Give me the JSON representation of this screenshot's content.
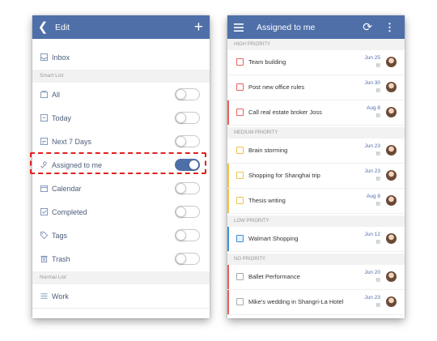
{
  "colors": {
    "accent": "#4f6fa8",
    "high": "#e86060",
    "medium": "#f2c14e",
    "low": "#3f8fd6",
    "highlight": "#e02020"
  },
  "left": {
    "header": {
      "back_icon": "back-arrow-icon",
      "title": "Edit",
      "add_icon": "plus-icon"
    },
    "inbox": {
      "label": "Inbox",
      "icon": "inbox-icon"
    },
    "smart_list_label": "Smart List",
    "smart_items": [
      {
        "label": "All",
        "icon": "all-icon",
        "toggle_on": false
      },
      {
        "label": "Today",
        "icon": "today-icon",
        "toggle_on": false
      },
      {
        "label": "Next 7 Days",
        "icon": "week-icon",
        "toggle_on": false
      },
      {
        "label": "Assigned to me",
        "icon": "assigned-icon",
        "toggle_on": true
      },
      {
        "label": "Calendar",
        "icon": "calendar-icon",
        "toggle_on": false
      },
      {
        "label": "Completed",
        "icon": "completed-icon",
        "toggle_on": false
      },
      {
        "label": "Tags",
        "icon": "tag-icon",
        "toggle_on": false
      },
      {
        "label": "Trash",
        "icon": "trash-icon",
        "toggle_on": false
      }
    ],
    "normal_list_label": "Normal List",
    "normal_items": [
      {
        "label": "Work",
        "icon": "list-icon"
      }
    ]
  },
  "right": {
    "header": {
      "menu_icon": "hamburger-icon",
      "title": "Assigned to me",
      "refresh_icon": "refresh-icon",
      "more_icon": "more-vert-icon"
    },
    "sections": [
      {
        "label": "HIGH PRIORITY",
        "tasks": [
          {
            "text": "Team building",
            "date": "Jun 25"
          },
          {
            "text": "Post new office rules",
            "date": "Jun 30"
          },
          {
            "text": "Call real estate broker Joss",
            "date": "Aug 8"
          }
        ]
      },
      {
        "label": "MEDIUM PRIORITY",
        "tasks": [
          {
            "text": "Brain storming",
            "date": "Jun 23"
          },
          {
            "text": "Shopping for Shanghai trip",
            "date": "Jun 23"
          },
          {
            "text": "Thesis writing",
            "date": "Aug 8"
          }
        ]
      },
      {
        "label": "LOW PRIORITY",
        "tasks": [
          {
            "text": "Walmart Shopping",
            "date": "Jun 12"
          }
        ]
      },
      {
        "label": "NO PRIORITY",
        "tasks": [
          {
            "text": "Ballet Performance",
            "date": "Jun 20"
          },
          {
            "text": "Mike's wedding in Shangri-La Hotel",
            "date": "Jun 23"
          }
        ]
      }
    ]
  }
}
